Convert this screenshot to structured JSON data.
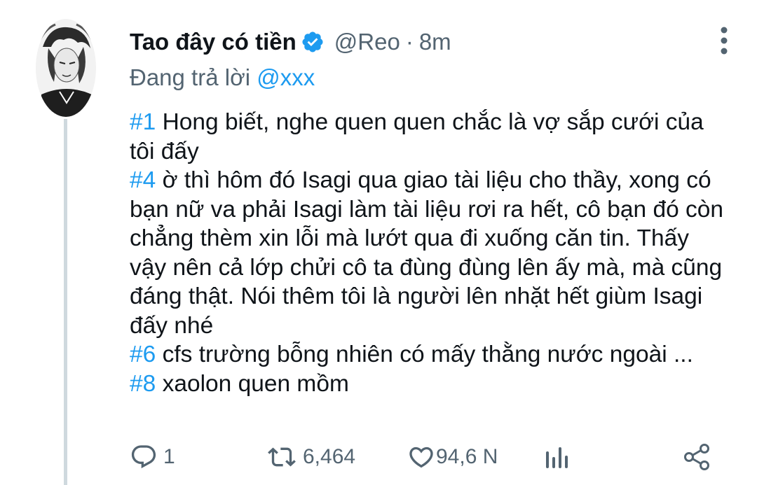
{
  "tweet": {
    "display_name": "Tao đây có tiền",
    "handle": "@Reo",
    "separator": "·",
    "time": "8m",
    "reply_prefix": "Đang trả lời",
    "reply_to": "@xxx",
    "paragraphs": [
      {
        "tag": "#1",
        "text": "Hong biết, nghe quen quen chắc là vợ sắp cưới của tôi đấy"
      },
      {
        "tag": "#4",
        "text": "ờ thì hôm đó Isagi qua giao tài liệu cho thầy, xong có bạn nữ va phải Isagi làm tài liệu rơi ra hết, cô bạn đó còn chẳng thèm xin lỗi mà lướt qua đi xuống căn tin. Thấy vậy nên cả lớp chửi cô ta đùng đùng lên ấy mà, mà cũng đáng thật. Nói thêm tôi là người lên nhặt hết giùm Isagi đấy nhé"
      },
      {
        "tag": "#6",
        "text": "cfs trường bỗng nhiên có mấy thằng nước ngoài ..."
      },
      {
        "tag": "#8",
        "text": "xaolon quen mồm"
      }
    ]
  },
  "actions": {
    "reply_count": "1",
    "retweet_count": "6,464",
    "like_count": "94,6 N"
  },
  "icons": {
    "verified": "verified-badge-icon",
    "more": "more-vertical-icon",
    "reply": "reply-icon",
    "retweet": "retweet-icon",
    "like": "heart-icon",
    "analytics": "analytics-icon",
    "share": "share-icon"
  },
  "colors": {
    "accent": "#1d9bf0",
    "text": "#0f1419",
    "secondary": "#536471",
    "thread_line": "#cfd9de"
  }
}
